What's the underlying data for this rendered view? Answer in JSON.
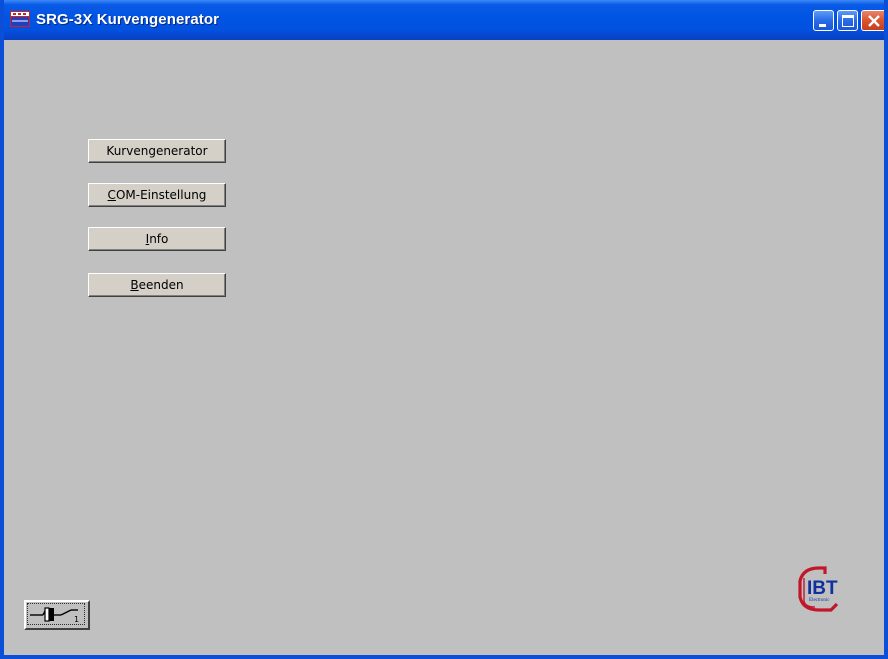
{
  "window": {
    "title": "SRG-3X Kurvengenerator",
    "icon": "app-window-icon"
  },
  "caption_buttons": {
    "minimize_icon": "minimize-icon",
    "maximize_icon": "maximize-icon",
    "close_icon": "close-icon"
  },
  "menu": {
    "buttons": [
      {
        "label_before": "",
        "mnemonic": "",
        "label_after": "Kurvengenerator"
      },
      {
        "label_before": "",
        "mnemonic": "C",
        "label_after": "OM-Einstellung"
      },
      {
        "label_before": "",
        "mnemonic": "I",
        "label_after": "nfo"
      },
      {
        "label_before": "",
        "mnemonic": "B",
        "label_after": "eenden"
      }
    ]
  },
  "logo": {
    "letters": "IBT",
    "subtitle": "Electronic",
    "colors": {
      "frame": "#c0182a",
      "letters": "#1030a0"
    }
  },
  "status_icon": {
    "name": "connection-plug-icon",
    "label": "1"
  },
  "colors": {
    "titlebar": "#0054e3",
    "background": "#c0c0c0",
    "close_button": "#d9542f"
  }
}
